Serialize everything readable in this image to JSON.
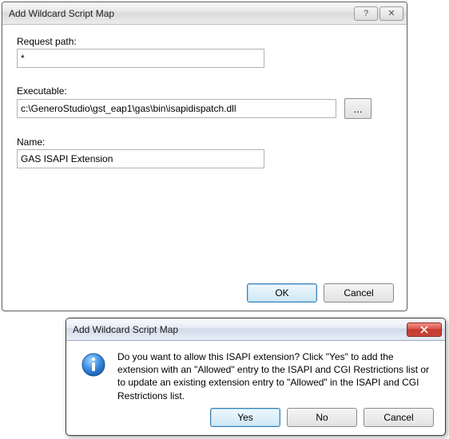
{
  "main_dialog": {
    "title": "Add Wildcard Script Map",
    "request_path_label": "Request path:",
    "request_path_value": "*",
    "executable_label": "Executable:",
    "executable_value": "c:\\GeneroStudio\\gst_eap1\\gas\\bin\\isapidispatch.dll",
    "browse_label": "...",
    "name_label": "Name:",
    "name_value": "GAS ISAPI Extension",
    "ok_label": "OK",
    "cancel_label": "Cancel",
    "help_glyph": "?",
    "close_glyph": "✕"
  },
  "confirm_dialog": {
    "title": "Add Wildcard Script Map",
    "message": "Do you want to allow this ISAPI extension? Click \"Yes\" to add the extension with an \"Allowed\" entry to the ISAPI and CGI Restrictions list or to update an existing extension entry to \"Allowed\" in the ISAPI and CGI Restrictions list.",
    "yes_label": "Yes",
    "no_label": "No",
    "cancel_label": "Cancel"
  }
}
